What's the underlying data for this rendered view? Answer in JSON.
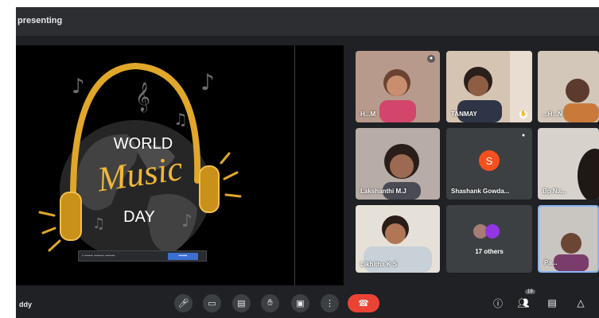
{
  "window": {
    "presenting_label": "presenting"
  },
  "slide": {
    "line1": "WORLD",
    "line2": "Music",
    "line3": "DAY"
  },
  "participants": [
    {
      "name": "...",
      "visible_name": "H...M"
    },
    {
      "name": "TANMAY"
    },
    {
      "name": "...H...N"
    },
    {
      "name": "Lakshanthi M.J"
    },
    {
      "name": "Shashank Gowda...",
      "initial": "S"
    },
    {
      "name": "Bp Na..."
    },
    {
      "name": "Likhitha K S"
    },
    {
      "name": "17 others"
    },
    {
      "name": "Pa..."
    }
  ],
  "meeting": {
    "caption": "ddy",
    "badge": "19"
  },
  "colors": {
    "accent": "#ea4335",
    "background": "#202124",
    "avatar": "#f4511e",
    "gold": "#e0a72a"
  }
}
